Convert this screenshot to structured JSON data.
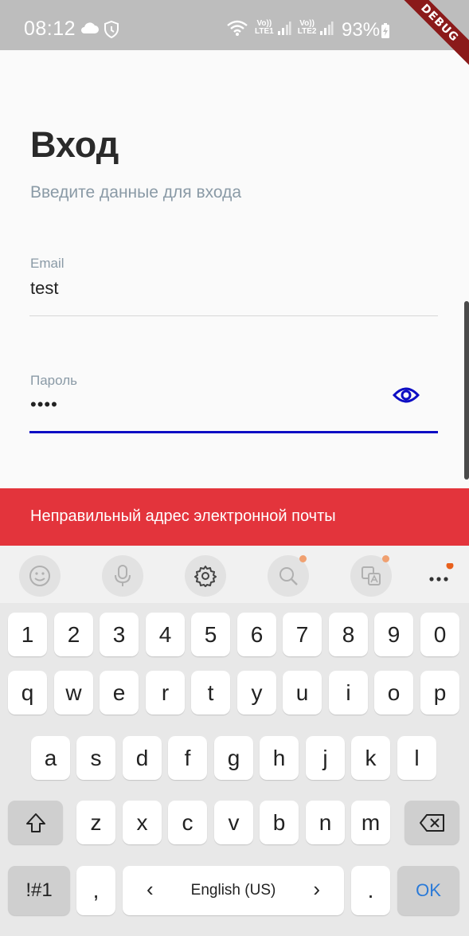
{
  "status_bar": {
    "time": "08:12",
    "lte1": [
      "Vo))",
      "LTE1"
    ],
    "lte2": [
      "Vo))",
      "LTE2"
    ],
    "battery": "93%",
    "debug_ribbon": "DEBUG"
  },
  "page": {
    "title": "Вход",
    "subtitle": "Введите данные для входа"
  },
  "form": {
    "email_label": "Email",
    "email_value": "test",
    "password_label": "Пароль",
    "password_value": "••••"
  },
  "snackbar": {
    "message": "Неправильный адрес электронной почты"
  },
  "keyboard": {
    "number_row": [
      "1",
      "2",
      "3",
      "4",
      "5",
      "6",
      "7",
      "8",
      "9",
      "0"
    ],
    "row1": [
      "q",
      "w",
      "e",
      "r",
      "t",
      "y",
      "u",
      "i",
      "o",
      "p"
    ],
    "row2": [
      "a",
      "s",
      "d",
      "f",
      "g",
      "h",
      "j",
      "k",
      "l"
    ],
    "row3": [
      "z",
      "x",
      "c",
      "v",
      "b",
      "n",
      "m"
    ],
    "symbols_key": "!#1",
    "comma_key": ",",
    "language": "English (US)",
    "lang_prev": "‹",
    "lang_next": "›",
    "period_key": ".",
    "ok_key": "OK"
  },
  "colors": {
    "accent": "#0d0dc4",
    "snackbar": "#e3343c",
    "statusbar": "#bdbdbd"
  }
}
